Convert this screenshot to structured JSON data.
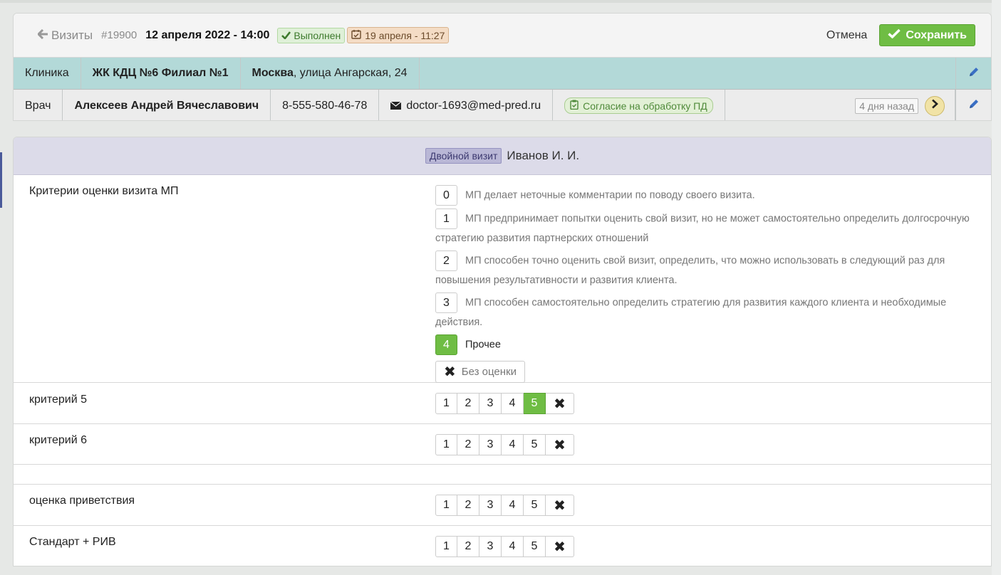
{
  "header": {
    "back_label": "Визиты",
    "visit_id": "#19900",
    "visit_date": "12 апреля 2022 - 14:00",
    "status_label": "Выполнен",
    "reminder_date": "19 апреля - 11:27",
    "cancel_label": "Отмена",
    "save_label": "Сохранить"
  },
  "clinic": {
    "label": "Клиника",
    "name": "ЖК КДЦ №6 Филиал №1",
    "city": "Москва",
    "address": ", улица Ангарская, 24"
  },
  "doctor": {
    "label": "Врач",
    "name": "Алексеев Андрей Вячеславович",
    "phone": "8-555-580-46-78",
    "email": "doctor-1693@med-pred.ru",
    "consent_label": "Согласие на обработку ПД",
    "last_seen": "4 дня назад"
  },
  "visit_panel": {
    "badge": "Двойной визит",
    "person": "Иванов И. И."
  },
  "criteria_main": {
    "label": "Критерии оценки визита МП",
    "options": [
      {
        "num": "0",
        "text": "МП делает неточные комментарии по поводу своего визита."
      },
      {
        "num": "1",
        "text": "МП предпринимает попытки оценить свой визит, но не может самостоятельно определить долгосрочную стратегию развития партнерских отношений"
      },
      {
        "num": "2",
        "text": "МП способен точно оценить свой визит, определить, что можно использовать в следующий раз для повышения результативности и развития клиента."
      },
      {
        "num": "3",
        "text": "МП способен самостоятельно определить стратегию для развития каждого клиента и необходимые действия."
      },
      {
        "num": "4",
        "text": "Прочее"
      }
    ],
    "selected": "4",
    "no_score_label": "Без оценки"
  },
  "criteria": [
    {
      "label": "критерий 5",
      "selected": "5"
    },
    {
      "label": "критерий 6",
      "selected": ""
    },
    {
      "label": "оценка приветствия",
      "selected": ""
    },
    {
      "label": "Стандарт + РИВ",
      "selected": ""
    }
  ],
  "scale": [
    "1",
    "2",
    "3",
    "4",
    "5"
  ],
  "colors": {
    "accent_green": "#6fbd44",
    "clinic_row": "#b3d9d8",
    "visit_header": "#dcdbe9"
  }
}
